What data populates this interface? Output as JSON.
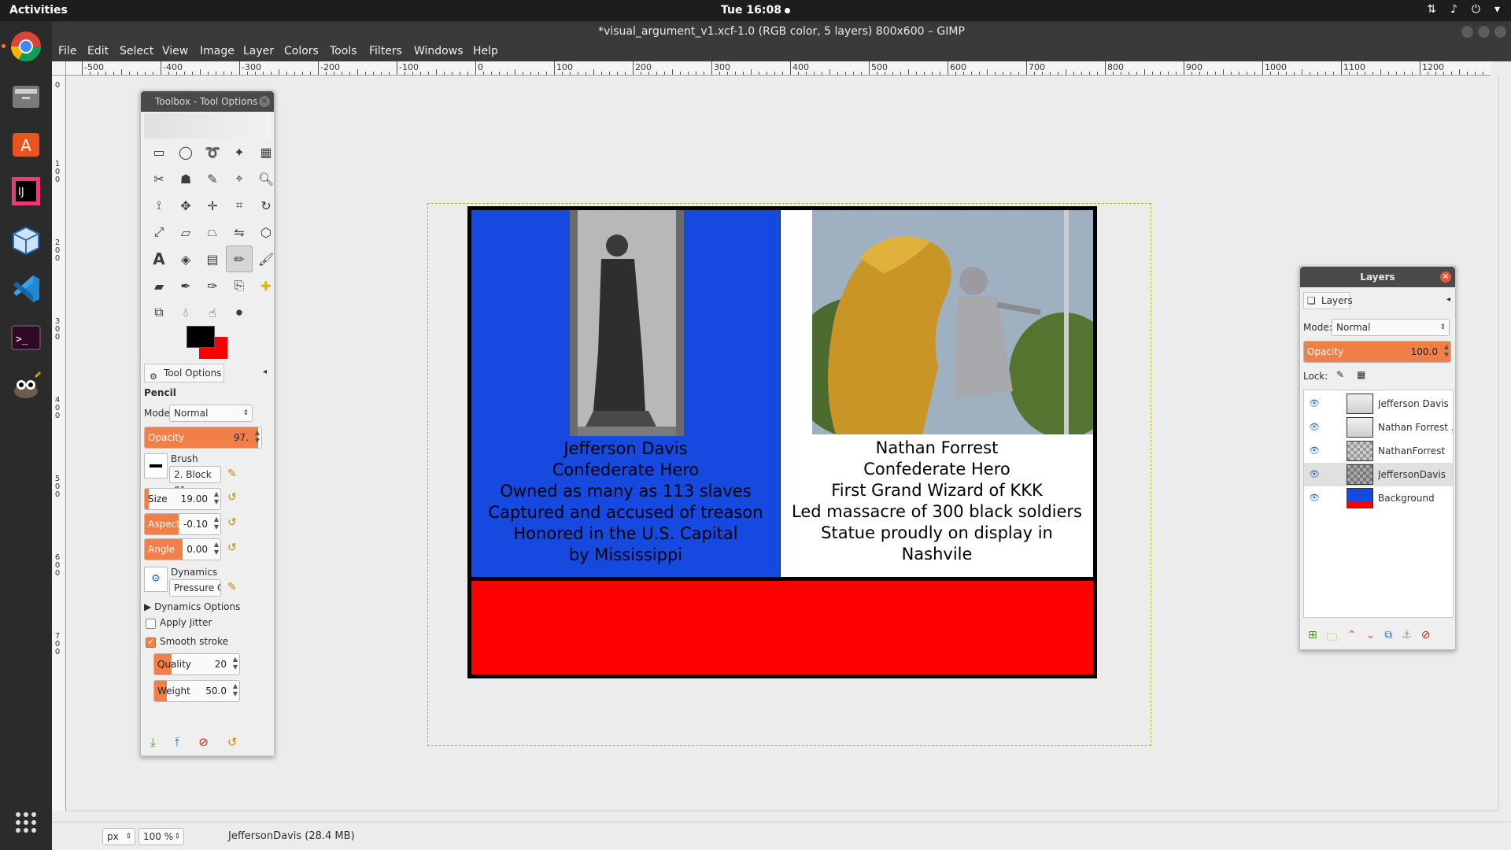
{
  "topbar": {
    "activities": "Activities",
    "clock": "Tue 16:08"
  },
  "dock": {
    "items": [
      "chrome-icon",
      "files-icon",
      "software-center-icon",
      "intellij-icon",
      "virtualbox-icon",
      "vscode-icon",
      "terminal-icon",
      "gimp-icon",
      "show-apps-icon"
    ]
  },
  "window": {
    "title": "*visual_argument_v1.xcf-1.0 (RGB color, 5 layers) 800x600 – GIMP"
  },
  "menu": [
    "File",
    "Edit",
    "Select",
    "View",
    "Image",
    "Layer",
    "Colors",
    "Tools",
    "Filters",
    "Windows",
    "Help"
  ],
  "ruler": {
    "h_labels": [
      "-500",
      "-400",
      "-300",
      "-200",
      "-100",
      "0",
      "100",
      "200",
      "300",
      "400",
      "500",
      "600",
      "700",
      "800",
      "900",
      "1000",
      "1100",
      "1200"
    ],
    "v_labels": [
      "0",
      "100",
      "200",
      "300",
      "400",
      "500",
      "600",
      "700"
    ]
  },
  "canvas": {
    "left_caption": [
      "Jefferson Davis",
      "Confederate Hero",
      "Owned as many as 113 slaves",
      "Captured and accused of treason",
      "Honored in the U.S. Capital",
      "by Mississippi"
    ],
    "right_caption": [
      "Nathan Forrest",
      "Confederate Hero",
      "First Grand Wizard of KKK",
      "Led massacre of 300 black soldiers",
      "Statue proudly on display in",
      "Nashvile"
    ],
    "colors": {
      "blue": "#1649e0",
      "red": "#ff0000",
      "white": "#ffffff",
      "frame": "#000000"
    }
  },
  "toolbox": {
    "title": "Toolbox - Tool Options",
    "tab_label": "Tool Options",
    "tool_name": "Pencil",
    "mode_label": "Mode:",
    "mode_value": "Normal",
    "opacity": {
      "label": "Opacity",
      "value": "97.",
      "fraction": 0.97
    },
    "brush_label": "Brush",
    "brush_value": "2. Block 01",
    "size": {
      "label": "Size",
      "value": "19.00",
      "fraction": 0.05
    },
    "aspect": {
      "label": "Aspect ...",
      "value": "-0.10",
      "fraction": 0.45
    },
    "angle": {
      "label": "Angle",
      "value": "0.00",
      "fraction": 0.5
    },
    "dynamics_label": "Dynamics",
    "dynamics_value": "Pressure Opac",
    "dynamics_options": "Dynamics Options",
    "apply_jitter": "Apply Jitter",
    "smooth_stroke": "Smooth stroke",
    "quality": {
      "label": "Quality",
      "value": "20",
      "fraction": 0.2
    },
    "weight": {
      "label": "Weight",
      "value": "50.0",
      "fraction": 0.15
    },
    "fg_color": "#000000",
    "bg_color": "#ff0000"
  },
  "layers": {
    "title": "Layers",
    "tab_label": "Layers",
    "mode_label": "Mode:",
    "mode_value": "Normal",
    "opacity_label": "Opacity",
    "opacity_value": "100.0",
    "lock_label": "Lock:",
    "items": [
      {
        "name": "Jefferson Davis ..."
      },
      {
        "name": "Nathan Forrest ..."
      },
      {
        "name": "NathanForrest"
      },
      {
        "name": "JeffersonDavis"
      },
      {
        "name": "Background"
      }
    ]
  },
  "status": {
    "unit": "px",
    "zoom": "100 %",
    "info": "JeffersonDavis (28.4 MB)"
  }
}
